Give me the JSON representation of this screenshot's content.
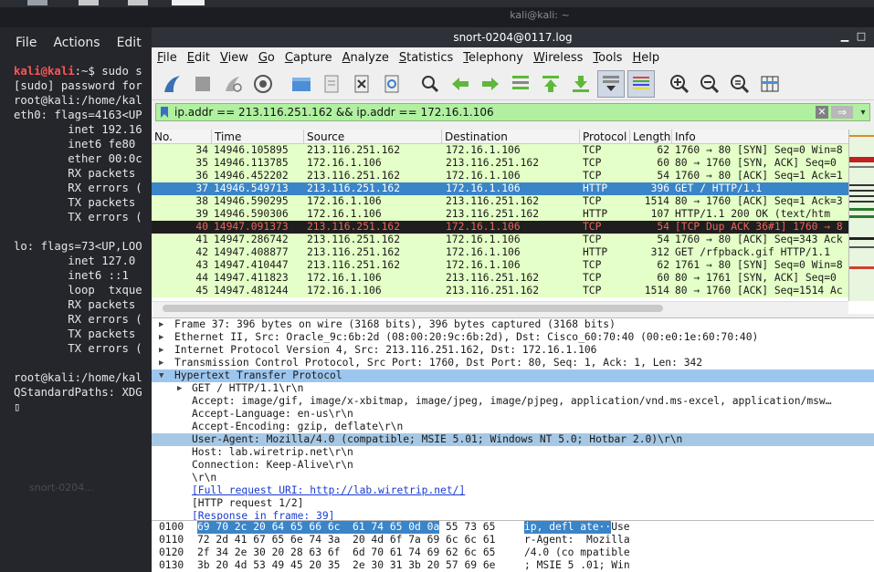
{
  "terminal": {
    "title": "kali@kali: ~",
    "menu": [
      "File",
      "Actions",
      "Edit"
    ],
    "lines": [
      {
        "user": "kali@kali",
        "rest": ":~$ sudo s"
      },
      {
        "text": "[sudo] password for"
      },
      {
        "text": "root@kali:/home/kal"
      },
      {
        "text": "eth0: flags=4163<UP"
      },
      {
        "text": "        inet 192.16"
      },
      {
        "text": "        inet6 fe80"
      },
      {
        "text": "        ether 00:0c"
      },
      {
        "text": "        RX packets"
      },
      {
        "text": "        RX errors ("
      },
      {
        "text": "        TX packets"
      },
      {
        "text": "        TX errors ("
      },
      {
        "text": ""
      },
      {
        "text": "lo: flags=73<UP,LOO"
      },
      {
        "text": "        inet 127.0"
      },
      {
        "text": "        inet6 ::1"
      },
      {
        "text": "        loop  txque"
      },
      {
        "text": "        RX packets"
      },
      {
        "text": "        RX errors ("
      },
      {
        "text": "        TX packets"
      },
      {
        "text": "        TX errors ("
      },
      {
        "text": ""
      },
      {
        "text": "root@kali:/home/kal"
      },
      {
        "text": "QStandardPaths: XDG"
      },
      {
        "text": "▯"
      }
    ],
    "desktop_ghost": "snort-0204..."
  },
  "window": {
    "title": "snort-0204@0117.log",
    "controls": [
      "▁",
      "□"
    ]
  },
  "menu": [
    "File",
    "Edit",
    "View",
    "Go",
    "Capture",
    "Analyze",
    "Statistics",
    "Telephony",
    "Wireless",
    "Tools",
    "Help"
  ],
  "toolbar": {
    "icons": [
      "shark-fin-icon",
      "stop-icon",
      "restart-icon",
      "options-gear-icon",
      "open-folder-icon",
      "save-file-icon",
      "close-file-icon",
      "reload-icon",
      "find-icon",
      "go-back-icon",
      "go-forward-icon",
      "go-to-packet-icon",
      "go-first-icon",
      "go-last-icon",
      "autoscroll-icon",
      "colorize-icon",
      "zoom-in-icon",
      "zoom-out-icon",
      "zoom-reset-icon",
      "resize-columns-icon"
    ]
  },
  "filter": {
    "value": "ip.addr == 213.116.251.162 && ip.addr == 172.16.1.106",
    "bg": "#b0f0a0"
  },
  "columns": [
    "No.",
    "Time",
    "Source",
    "Destination",
    "Protocol",
    "Length",
    "Info"
  ],
  "packets": [
    {
      "no": "34",
      "time": "14946.105895",
      "src": "213.116.251.162",
      "dst": "172.16.1.106",
      "proto": "TCP",
      "len": "62",
      "info": "1760 → 80 [SYN] Seq=0 Win=8",
      "style": "normal"
    },
    {
      "no": "35",
      "time": "14946.113785",
      "src": "172.16.1.106",
      "dst": "213.116.251.162",
      "proto": "TCP",
      "len": "60",
      "info": "80 → 1760 [SYN, ACK] Seq=0",
      "style": "normal"
    },
    {
      "no": "36",
      "time": "14946.452202",
      "src": "213.116.251.162",
      "dst": "172.16.1.106",
      "proto": "TCP",
      "len": "54",
      "info": "1760 → 80 [ACK] Seq=1 Ack=1",
      "style": "normal"
    },
    {
      "no": "37",
      "time": "14946.549713",
      "src": "213.116.251.162",
      "dst": "172.16.1.106",
      "proto": "HTTP",
      "len": "396",
      "info": "GET / HTTP/1.1",
      "style": "sel"
    },
    {
      "no": "38",
      "time": "14946.590295",
      "src": "172.16.1.106",
      "dst": "213.116.251.162",
      "proto": "TCP",
      "len": "1514",
      "info": "80 → 1760 [ACK] Seq=1 Ack=3",
      "style": "normal"
    },
    {
      "no": "39",
      "time": "14946.590306",
      "src": "172.16.1.106",
      "dst": "213.116.251.162",
      "proto": "HTTP",
      "len": "107",
      "info": "HTTP/1.1 200 OK  (text/htm",
      "style": "normal"
    },
    {
      "no": "40",
      "time": "14947.091373",
      "src": "213.116.251.162",
      "dst": "172.16.1.106",
      "proto": "TCP",
      "len": "54",
      "info": "[TCP Dup ACK 36#1] 1760 → 8",
      "style": "bad"
    },
    {
      "no": "41",
      "time": "14947.286742",
      "src": "213.116.251.162",
      "dst": "172.16.1.106",
      "proto": "TCP",
      "len": "54",
      "info": "1760 → 80 [ACK] Seq=343 Ack",
      "style": "normal"
    },
    {
      "no": "42",
      "time": "14947.408877",
      "src": "213.116.251.162",
      "dst": "172.16.1.106",
      "proto": "HTTP",
      "len": "312",
      "info": "GET /rfpback.gif HTTP/1.1",
      "style": "normal"
    },
    {
      "no": "43",
      "time": "14947.410447",
      "src": "213.116.251.162",
      "dst": "172.16.1.106",
      "proto": "TCP",
      "len": "62",
      "info": "1761 → 80 [SYN] Seq=0 Win=8",
      "style": "normal"
    },
    {
      "no": "44",
      "time": "14947.411823",
      "src": "172.16.1.106",
      "dst": "213.116.251.162",
      "proto": "TCP",
      "len": "60",
      "info": "80 → 1761 [SYN, ACK] Seq=0",
      "style": "normal"
    },
    {
      "no": "45",
      "time": "14947.481244",
      "src": "172.16.1.106",
      "dst": "213.116.251.162",
      "proto": "TCP",
      "len": "1514",
      "info": "80 → 1760 [ACK] Seq=1514 Ac",
      "style": "normal"
    }
  ],
  "details": [
    {
      "text": "Frame 37: 396 bytes on wire (3168 bits), 396 bytes captured (3168 bits)",
      "kind": "collapsed"
    },
    {
      "text": "Ethernet II, Src: Oracle_9c:6b:2d (08:00:20:9c:6b:2d), Dst: Cisco_60:70:40 (00:e0:1e:60:70:40)",
      "kind": "collapsed"
    },
    {
      "text": "Internet Protocol Version 4, Src: 213.116.251.162, Dst: 172.16.1.106",
      "kind": "collapsed"
    },
    {
      "text": "Transmission Control Protocol, Src Port: 1760, Dst Port: 80, Seq: 1, Ack: 1, Len: 342",
      "kind": "collapsed"
    },
    {
      "text": "Hypertext Transfer Protocol",
      "kind": "expanded-hl"
    },
    {
      "text": "GET / HTTP/1.1\\r\\n",
      "kind": "child-collapsed"
    },
    {
      "text": "Accept: image/gif, image/x-xbitmap, image/jpeg, image/pjpeg, application/vnd.ms-excel, application/msw…",
      "kind": "child"
    },
    {
      "text": "Accept-Language: en-us\\r\\n",
      "kind": "child"
    },
    {
      "text": "Accept-Encoding: gzip, deflate\\r\\n",
      "kind": "child"
    },
    {
      "text": "User-Agent: Mozilla/4.0 (compatible; MSIE 5.01; Windows NT 5.0; Hotbar 2.0)\\r\\n",
      "kind": "child-ua"
    },
    {
      "text": "Host: lab.wiretrip.net\\r\\n",
      "kind": "child"
    },
    {
      "text": "Connection: Keep-Alive\\r\\n",
      "kind": "child"
    },
    {
      "text": "\\r\\n",
      "kind": "child"
    },
    {
      "text": "[Full request URI: http://lab.wiretrip.net/]",
      "kind": "child-link"
    },
    {
      "text": "[HTTP request 1/2]",
      "kind": "child"
    },
    {
      "text": "[Response in frame: 39]",
      "kind": "child-link2"
    }
  ],
  "bytes": [
    {
      "offset": "0100",
      "hex_sel": "69 70 2c 20 64 65 66 6c  61 74 65 0d 0a",
      "hex_rest": " 55 73 65",
      "ascii_sel": "ip, defl ate··",
      "ascii_rest": "Use"
    },
    {
      "offset": "0110",
      "hex_sel": "",
      "hex_rest": "72 2d 41 67 65 6e 74 3a  20 4d 6f 7a 69 6c 6c 61",
      "ascii_sel": "",
      "ascii_rest": "r-Agent:  Mozilla"
    },
    {
      "offset": "0120",
      "hex_sel": "",
      "hex_rest": "2f 34 2e 30 20 28 63 6f  6d 70 61 74 69 62 6c 65",
      "ascii_sel": "",
      "ascii_rest": "/4.0 (co mpatible"
    },
    {
      "offset": "0130",
      "hex_sel": "",
      "hex_rest": "3b 20 4d 53 49 45 20 35  2e 30 31 3b 20 57 69 6e",
      "ascii_sel": "",
      "ascii_rest": "; MSIE 5 .01; Win"
    }
  ]
}
